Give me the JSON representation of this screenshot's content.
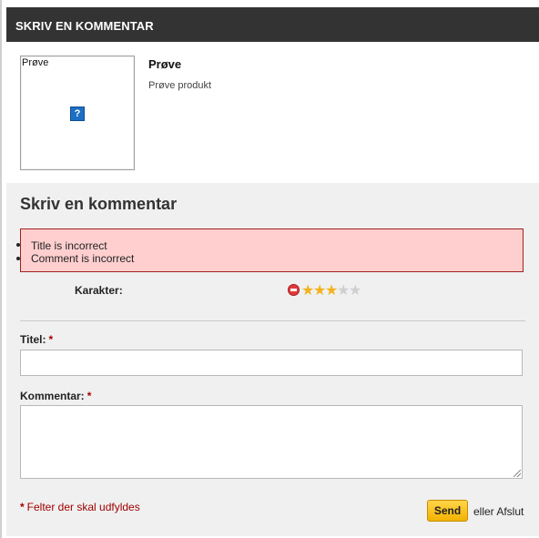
{
  "header": {
    "title": "SKRIV EN KOMMENTAR"
  },
  "product": {
    "image_alt": "Prøve",
    "name": "Prøve",
    "description": "Prøve produkt",
    "broken_image_glyph": "?"
  },
  "form": {
    "title": "Skriv en kommentar",
    "errors": [
      "Title is incorrect",
      "Comment is incorrect"
    ],
    "rating": {
      "label": "Karakter:",
      "value": 3,
      "max": 5,
      "star_on": "★",
      "star_off": "★",
      "star_color_on": "#f2b21d",
      "star_color_off": "#cfcfcf",
      "cancel_icon": "minus-circle-icon"
    },
    "fields": {
      "title_label": "Titel:",
      "title_value": "",
      "comment_label": "Kommentar:",
      "comment_value": "",
      "required_mark": "*"
    },
    "required_note": {
      "mark": "*",
      "text": "Felter der skal udfyldes"
    },
    "send_label": "Send",
    "or_cancel": "eller Afslut"
  },
  "colors": {
    "header_bg": "#333333",
    "error_bg": "#ffcfcf",
    "error_border": "#a32020",
    "required": "#a00000",
    "send_button": "#f2b300"
  }
}
